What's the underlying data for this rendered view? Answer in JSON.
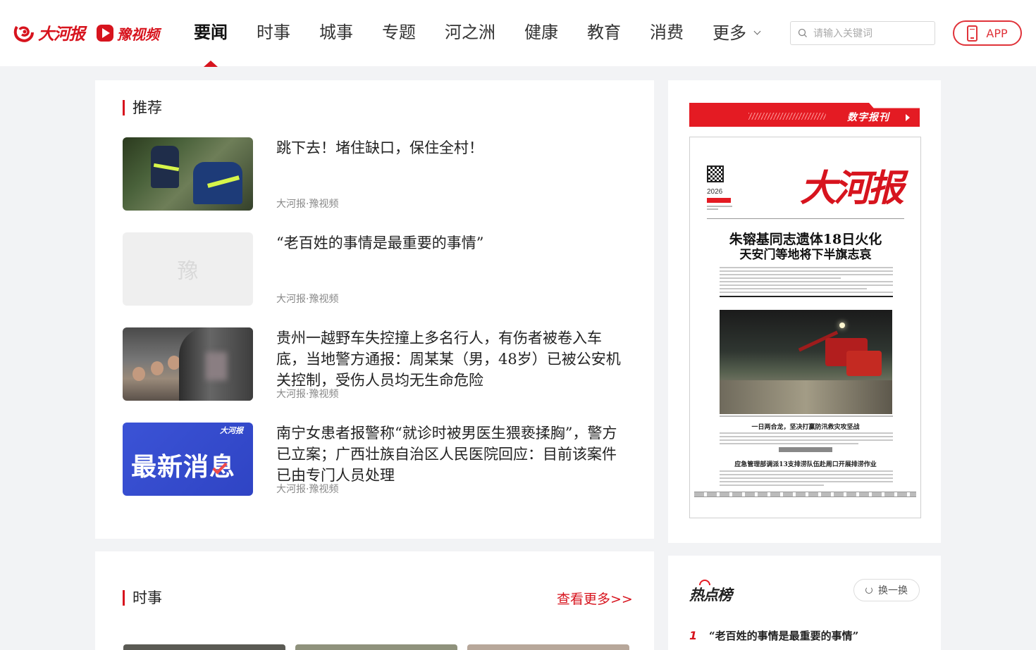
{
  "header": {
    "logo_dahe": "大河报",
    "logo_yu": "豫视频",
    "nav": [
      {
        "label": "要闻",
        "active": true
      },
      {
        "label": "时事",
        "active": false
      },
      {
        "label": "城事",
        "active": false
      },
      {
        "label": "专题",
        "active": false
      },
      {
        "label": "河之洲",
        "active": false
      },
      {
        "label": "健康",
        "active": false
      },
      {
        "label": "教育",
        "active": false
      },
      {
        "label": "消费",
        "active": false
      },
      {
        "label": "更多",
        "active": false,
        "has_dropdown": true
      }
    ],
    "search_placeholder": "请输入关键词",
    "app_button": "APP",
    "accent_color": "#d7141e"
  },
  "recommend": {
    "title": "推荐",
    "items": [
      {
        "title": "跳下去！堵住缺口，保住全村！",
        "source": "大河报·豫视频",
        "thumb": "flood-rescue-photo"
      },
      {
        "title": "“老百姓的事情是最重要的事情”",
        "source": "大河报·豫视频",
        "thumb": "placeholder",
        "placeholder_char": "豫"
      },
      {
        "title": "贵州一越野车失控撞上多名行人，有伤者被卷入车底，当地警方通报：周某某（男，48岁）已被公安机关控制，受伤人员均无生命危险",
        "source": "大河报·豫视频",
        "thumb": "street-accident-photo"
      },
      {
        "title": "南宁女患者报警称“就诊时被男医生猥亵揉胸”，警方已立案；广西壮族自治区人民医院回应：目前该案件已由专门人员处理",
        "source": "大河报·豫视频",
        "thumb": "breaking-news-graphic",
        "thumb_text": "最新消息",
        "thumb_logo": "大河报"
      }
    ]
  },
  "newspaper": {
    "banner_label": "数字报刊",
    "masthead": "大河报",
    "year": "2026",
    "headline_line1": "朱镕基同志遗体18日火化",
    "headline_line2": "天安门等地将下半旗志哀",
    "photo_caption_headline": "一日两合龙，坚决打赢防汛救灾攻坚战",
    "bottom_headline": "应急管理部调派13支排涝队伍赴周口开展排涝作业"
  },
  "shishi": {
    "title": "时事",
    "more_link": "查看更多>>"
  },
  "hot_list": {
    "title": "热点榜",
    "refresh_label": "换一换",
    "items": [
      {
        "rank": "1",
        "title": "“老百姓的事情是最重要的事情”"
      }
    ]
  }
}
